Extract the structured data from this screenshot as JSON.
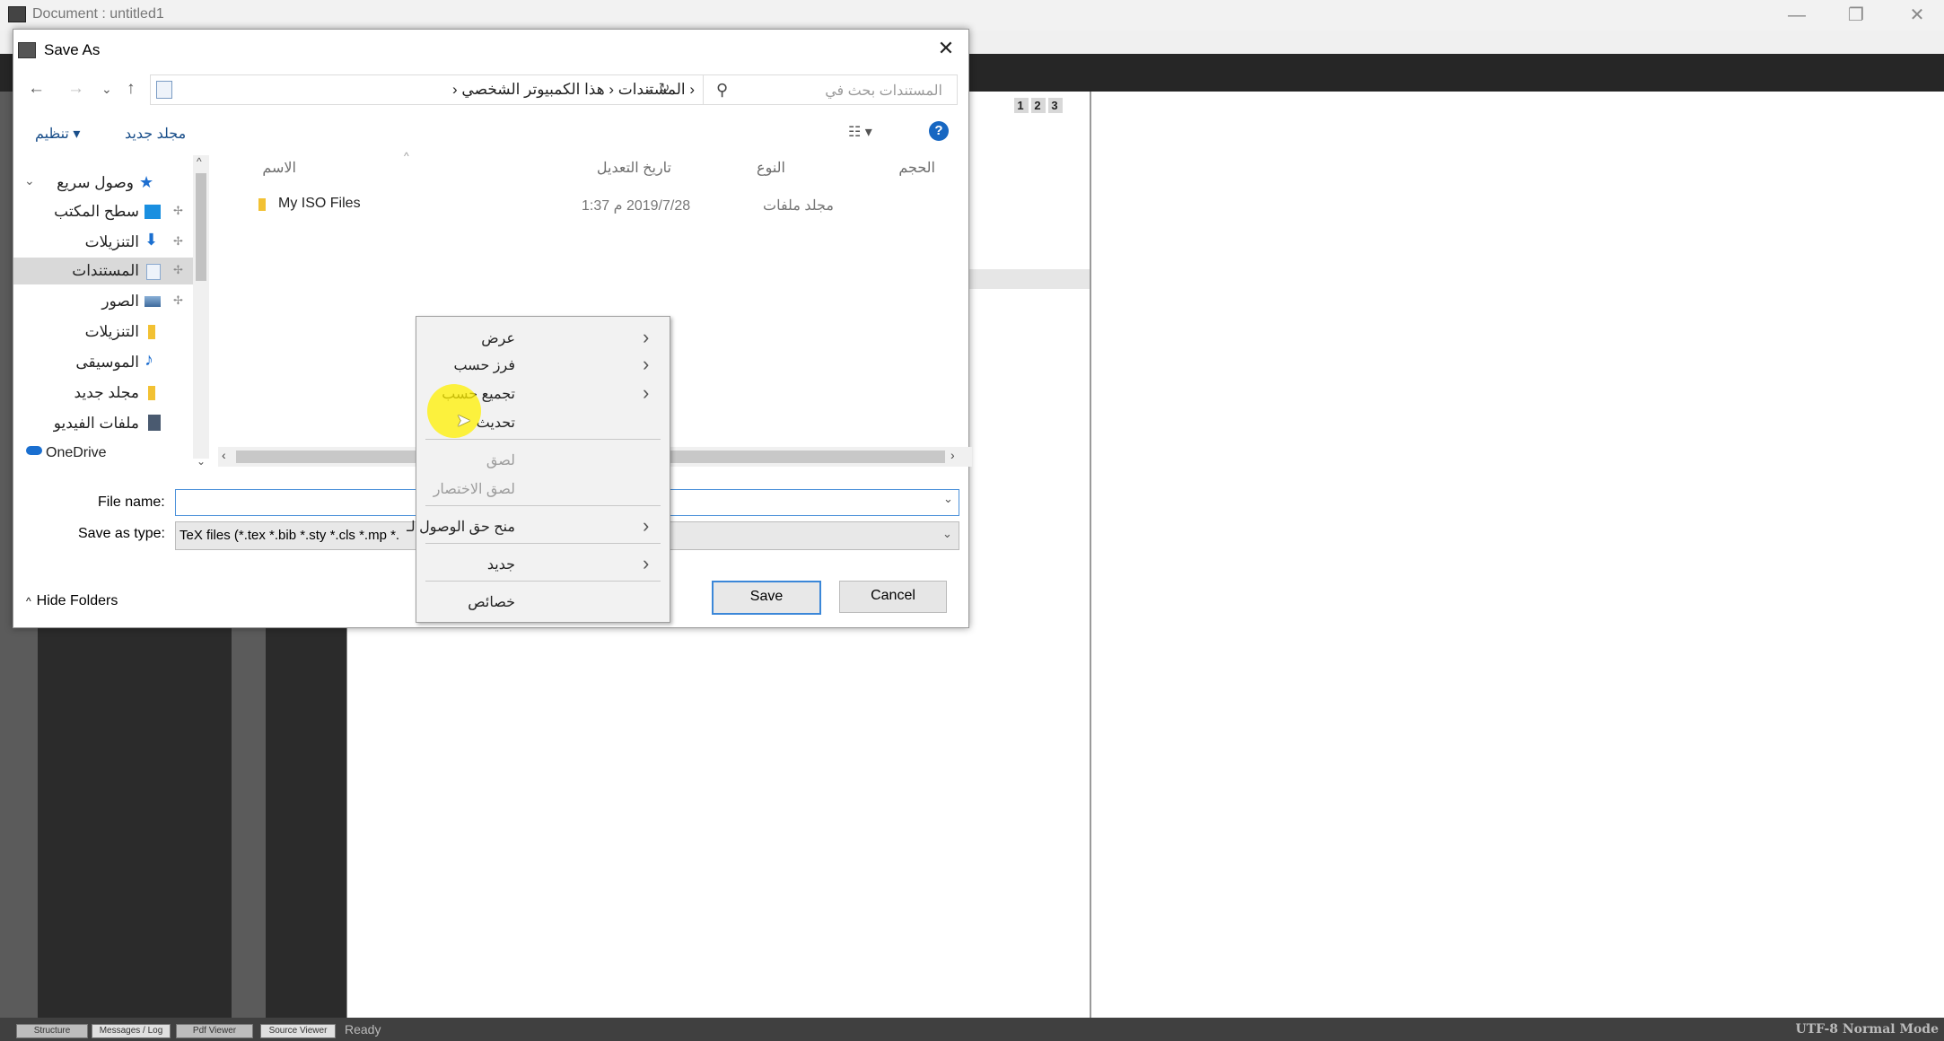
{
  "app": {
    "title": "Document : untitled1",
    "minimize": "—",
    "maximize": "❐",
    "close": "✕",
    "pane_numbers": [
      "1",
      "2",
      "3"
    ],
    "status_tabs": [
      "Structure",
      "Messages / Log",
      "Pdf Viewer",
      "Source Viewer"
    ],
    "status_ready": "Ready",
    "status_right": "UTF-8   Normal Mode"
  },
  "dialog": {
    "title": "Save As",
    "close": "✕",
    "nav": {
      "back": "←",
      "forward": "→",
      "recent": "⌄",
      "up": "↑"
    },
    "address": "‹ المستندات ‹ هذا الكمبيوتر الشخصي ‹",
    "address_dropdown": "⌄  ↻",
    "search_placeholder": "المستندات بحث في",
    "search_icon": "⚲",
    "organize": "تنظيم ▾",
    "new_folder": "مجلد جديد",
    "view_icon": "☷ ▾",
    "help": "?",
    "nav_pane": [
      {
        "label": "وصول سريع",
        "icon": "star-icon",
        "color": "#1e6fd0",
        "pinned": false
      },
      {
        "label": "سطح المكتب",
        "icon": "desktop-icon",
        "color": "#1a8fe0",
        "pinned": true
      },
      {
        "label": "التنزيلات",
        "icon": "download-icon",
        "color": "#1a6fd0",
        "pinned": true
      },
      {
        "label": "المستندات",
        "icon": "document-icon",
        "color": "#9fb7d3",
        "pinned": true
      },
      {
        "label": "الصور",
        "icon": "pictures-icon",
        "color": "#5a7fa8",
        "pinned": true
      },
      {
        "label": "التنزيلات",
        "icon": "folder-icon",
        "color": "#f2c133",
        "pinned": false
      },
      {
        "label": "الموسيقى",
        "icon": "music-icon",
        "color": "#1f6fd0",
        "pinned": false
      },
      {
        "label": "مجلد جديد",
        "icon": "folder-icon",
        "color": "#f2c133",
        "pinned": false
      },
      {
        "label": "ملفات الفيديو",
        "icon": "video-icon",
        "color": "#4a5a70",
        "pinned": false
      },
      {
        "label": "OneDrive",
        "icon": "cloud-icon",
        "color": "#1a6fd0",
        "pinned": false
      }
    ],
    "columns": {
      "name": "الاسم",
      "date": "تاريخ التعديل",
      "type": "النوع",
      "size": "الحجم"
    },
    "files": [
      {
        "name": "My ISO Files",
        "date": "2019/7/28 م 1:37",
        "type": "مجلد ملفات",
        "size": ""
      }
    ],
    "file_name_label": "File name:",
    "file_name_value": "",
    "save_type_label": "Save as type:",
    "save_type_value": "TeX files (*.tex *.bib *.sty *.cls *.mp *.",
    "hide_folders": "Hide Folders",
    "save": "Save",
    "cancel": "Cancel"
  },
  "context_menu": [
    {
      "label": "عرض",
      "submenu": true,
      "enabled": true
    },
    {
      "label": "فرز حسب",
      "submenu": true,
      "enabled": true
    },
    {
      "label": "تجميع حسب",
      "submenu": true,
      "enabled": true
    },
    {
      "label": "تحديث",
      "submenu": false,
      "enabled": true
    },
    {
      "label": "لصق",
      "submenu": false,
      "enabled": false
    },
    {
      "label": "لصق الاختصار",
      "submenu": false,
      "enabled": false
    },
    {
      "label": "منح حق الوصول لـ",
      "submenu": true,
      "enabled": true
    },
    {
      "label": "جديد",
      "submenu": true,
      "enabled": true
    },
    {
      "label": "خصائص",
      "submenu": false,
      "enabled": true
    }
  ],
  "colors": {
    "accent": "#1767c2",
    "highlight": "#fff000",
    "toolbar": "#262626"
  }
}
